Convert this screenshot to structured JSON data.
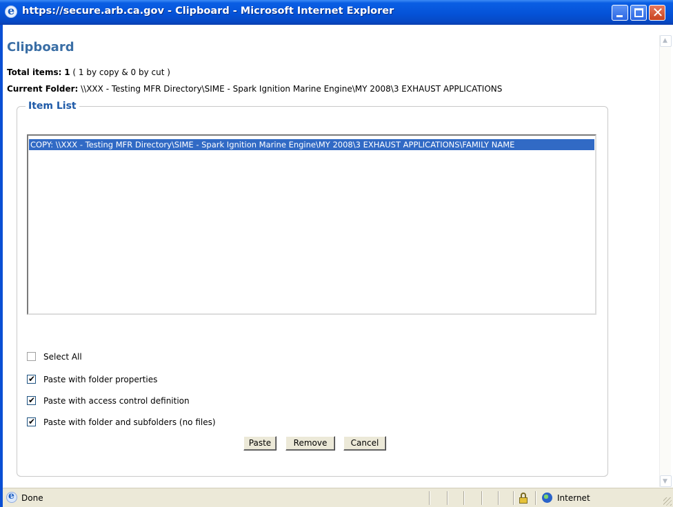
{
  "window": {
    "title": "https://secure.arb.ca.gov - Clipboard - Microsoft Internet Explorer"
  },
  "page": {
    "title": "Clipboard",
    "total_label": "Total items:",
    "total_value": "1",
    "total_detail": "( 1 by copy & 0 by cut )",
    "folder_label": "Current Folder:",
    "folder_value": "\\\\XXX - Testing MFR Directory\\SIME - Spark Ignition Marine Engine\\MY 2008\\3 EXHAUST APPLICATIONS"
  },
  "item_list": {
    "legend": "Item List",
    "items": [
      "COPY:   \\\\XXX - Testing MFR Directory\\SIME - Spark Ignition Marine Engine\\MY 2008\\3 EXHAUST APPLICATIONS\\FAMILY NAME"
    ]
  },
  "options": {
    "select_all": {
      "label": "Select All",
      "checked": false
    },
    "folder_properties": {
      "label": "Paste with folder properties",
      "checked": true
    },
    "access_control": {
      "label": "Paste with access control definition",
      "checked": true
    },
    "subfolders": {
      "label": "Paste with folder and subfolders (no files)",
      "checked": true
    }
  },
  "buttons": {
    "paste": "Paste",
    "remove": "Remove",
    "cancel": "Cancel"
  },
  "statusbar": {
    "status": "Done",
    "zone": "Internet"
  },
  "icons": [
    "ie-icon",
    "minimize-icon",
    "maximize-icon",
    "close-icon",
    "lock-icon",
    "globe-icon"
  ],
  "colors": {
    "titlebar": "#0553d8",
    "heading": "#3a6ea5",
    "legend": "#1e5aa8",
    "selection": "#316ac5"
  }
}
